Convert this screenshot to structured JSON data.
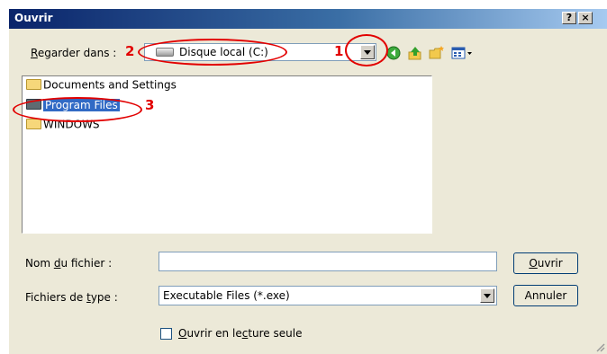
{
  "window": {
    "title": "Ouvrir",
    "help_glyph": "?",
    "close_glyph": "×"
  },
  "lookin": {
    "label_underlined": "R",
    "label_rest": "egarder dans :",
    "value": "Disque local (C:)"
  },
  "files": [
    {
      "name": "Documents and Settings",
      "selected": false
    },
    {
      "name": "Program Files",
      "selected": true
    },
    {
      "name": "WINDOWS",
      "selected": false
    }
  ],
  "filename": {
    "label_pre": "Nom ",
    "label_underlined": "d",
    "label_post": "u fichier :",
    "value": ""
  },
  "filetype": {
    "label_pre": "Fichiers de ",
    "label_underlined": "t",
    "label_post": "ype :",
    "value": "Executable Files (*.exe)"
  },
  "buttons": {
    "open_underlined": "O",
    "open_rest": "uvrir",
    "cancel": "Annuler"
  },
  "readonly": {
    "label_underlined": "O",
    "label_mid": "uvrir en le",
    "label_underlined2": "c",
    "label_post": "ture seule",
    "checked": false
  },
  "annotations": {
    "n1": "1",
    "n2": "2",
    "n3": "3",
    "color": "#e20000"
  },
  "icons": [
    "drive-icon",
    "back-icon",
    "up-folder-icon",
    "new-folder-icon",
    "view-menu-icon",
    "folder-icon"
  ]
}
